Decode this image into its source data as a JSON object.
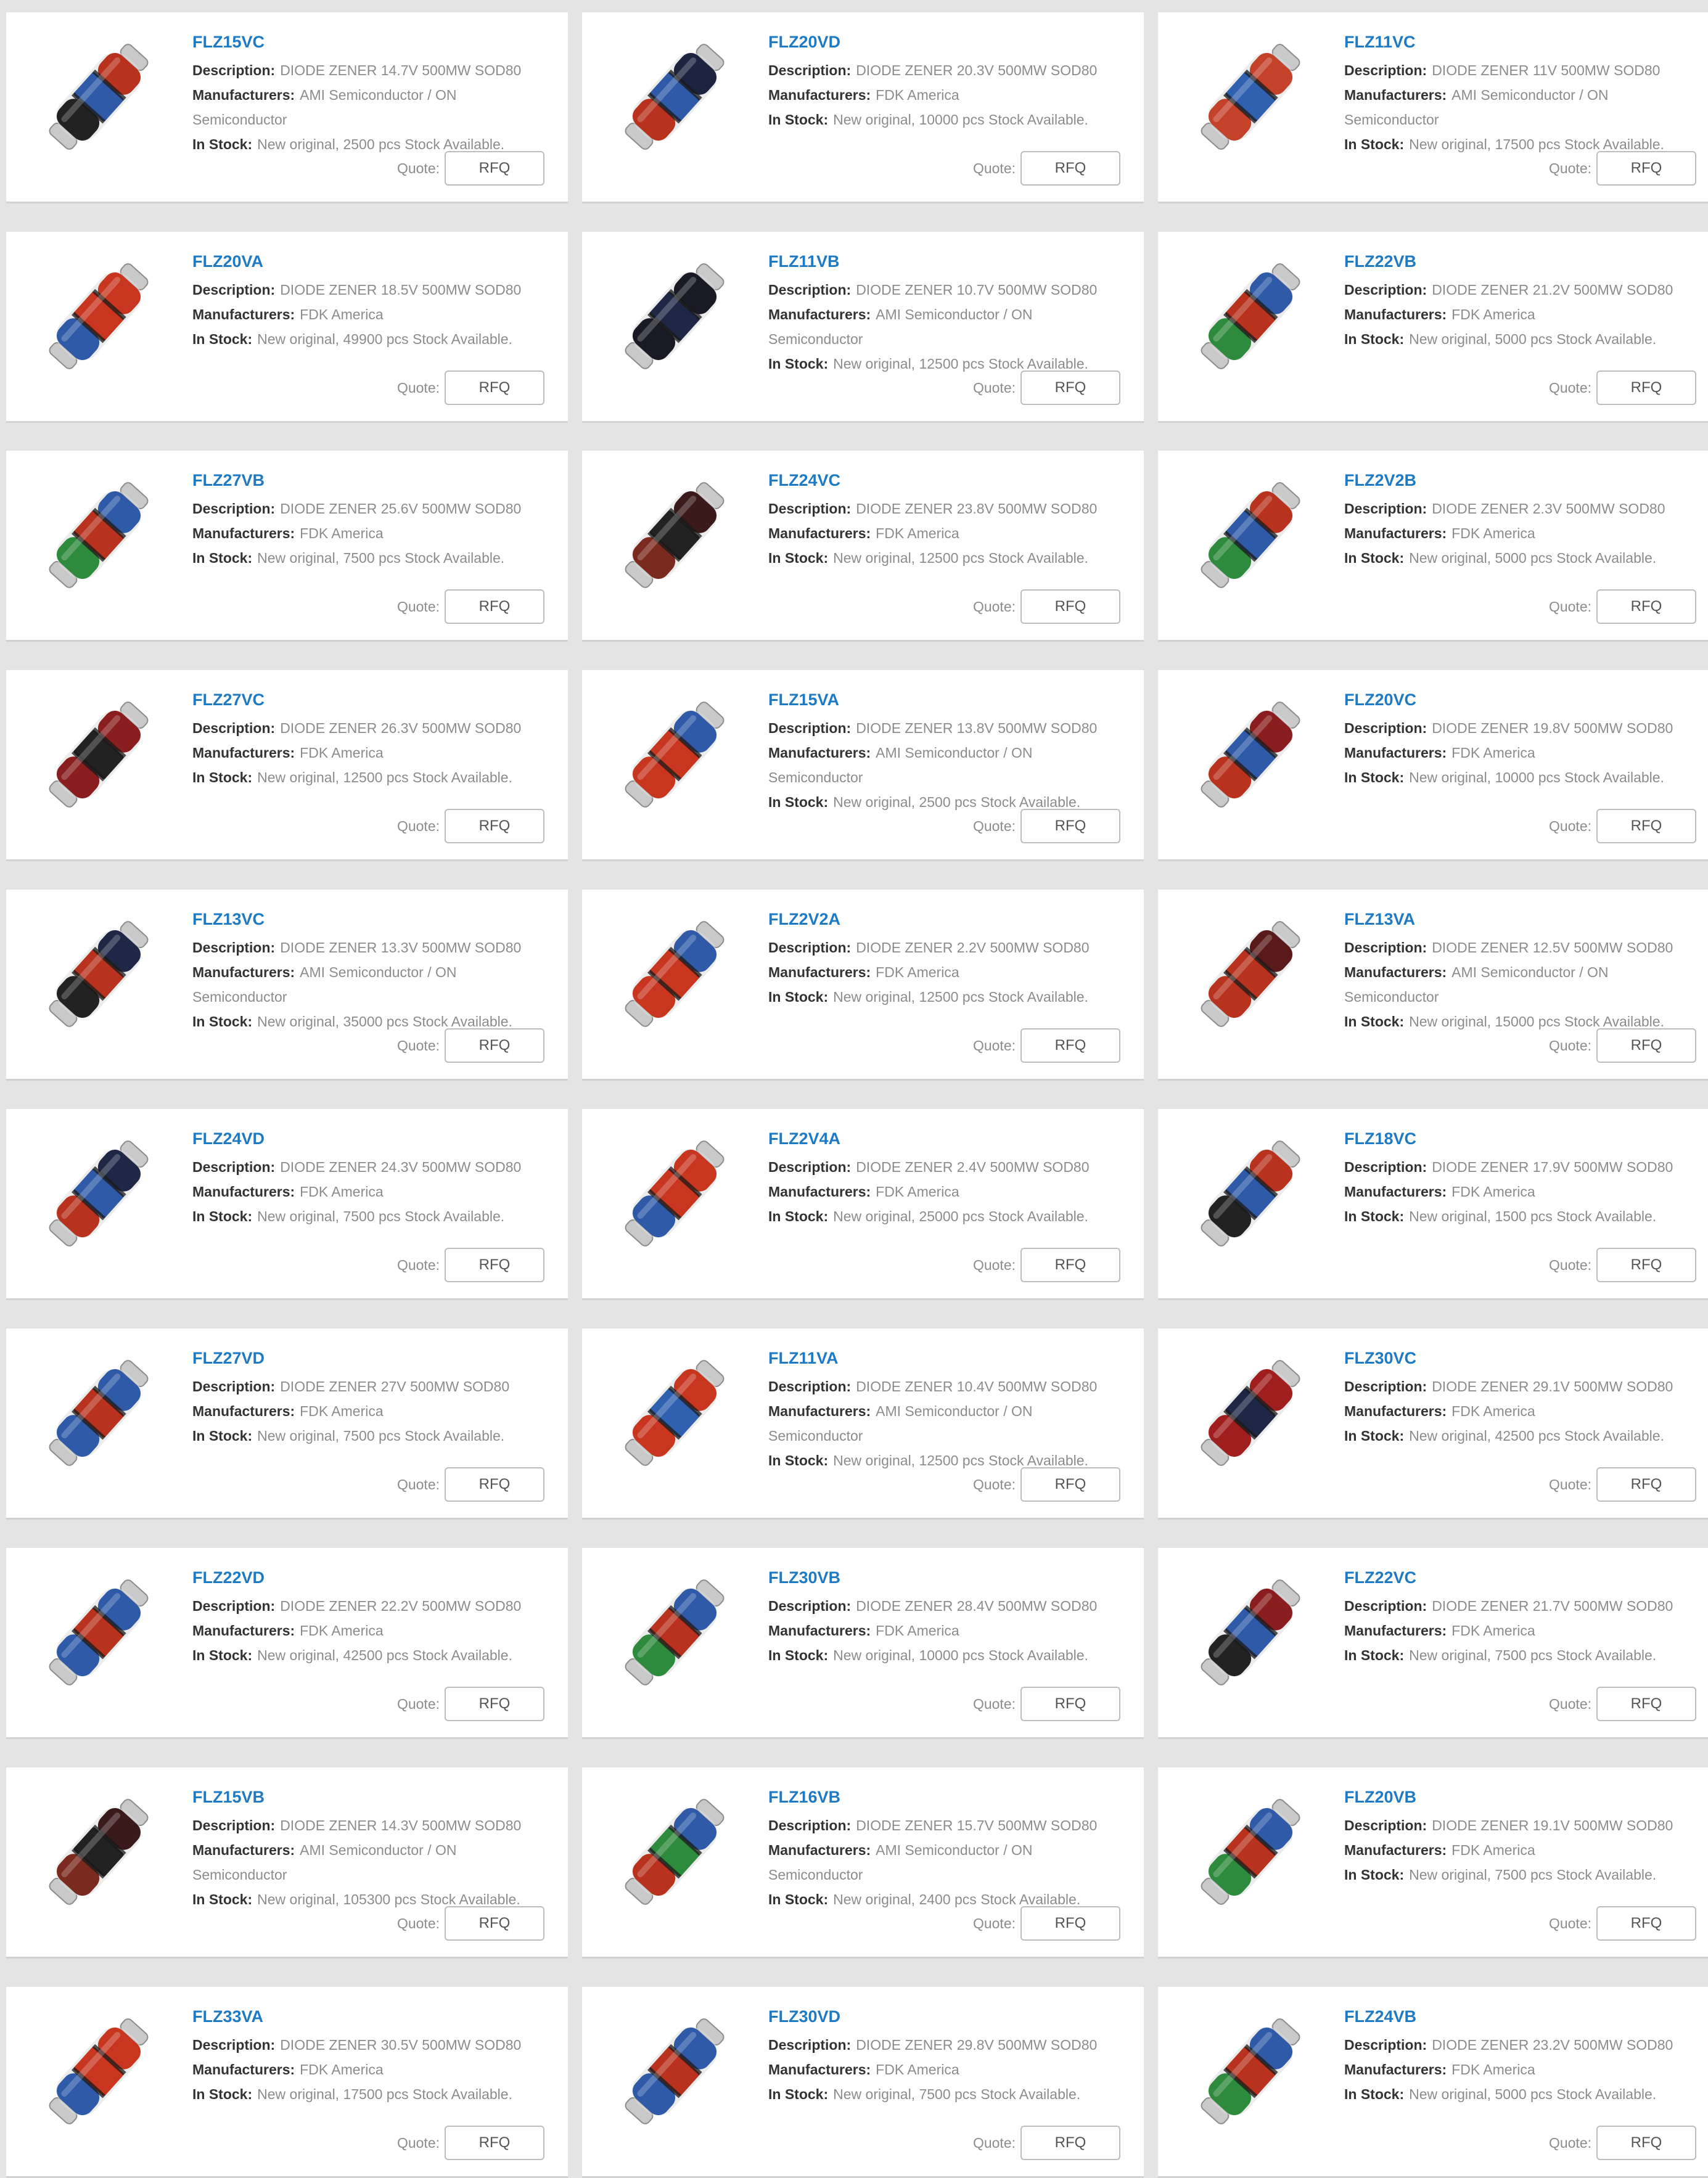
{
  "labels": {
    "description": "Description:",
    "manufacturers": "Manufacturers:",
    "in_stock": "In Stock:",
    "quote": "Quote:",
    "rfq": "RFQ"
  },
  "products": [
    {
      "part": "FLZ15VC",
      "description": "DIODE ZENER 14.7V 500MW SOD80",
      "manufacturer": "AMI Semiconductor / ON Semiconductor",
      "stock": "New original, 2500 pcs Stock Available.",
      "colors": [
        "#b8321e",
        "#2f5aa8",
        "#222222"
      ]
    },
    {
      "part": "FLZ20VD",
      "description": "DIODE ZENER 20.3V 500MW SOD80",
      "manufacturer": "FDK America",
      "stock": "New original, 10000 pcs Stock Available.",
      "colors": [
        "#1d2440",
        "#2f5aa8",
        "#b8321e"
      ]
    },
    {
      "part": "FLZ11VC",
      "description": "DIODE ZENER 11V 500MW SOD80",
      "manufacturer": "AMI Semiconductor / ON Semiconductor",
      "stock": "New original, 17500 pcs Stock Available.",
      "colors": [
        "#c4412a",
        "#3060b0",
        "#c4412a"
      ]
    },
    {
      "part": "FLZ20VA",
      "description": "DIODE ZENER 18.5V 500MW SOD80",
      "manufacturer": "FDK America",
      "stock": "New original, 49900 pcs Stock Available.",
      "colors": [
        "#c8361f",
        "#c8361f",
        "#2f5aa8"
      ]
    },
    {
      "part": "FLZ11VB",
      "description": "DIODE ZENER 10.7V 500MW SOD80",
      "manufacturer": "AMI Semiconductor / ON Semiconductor",
      "stock": "New original, 12500 pcs Stock Available.",
      "colors": [
        "#1a1a26",
        "#1e2846",
        "#1a1a26"
      ]
    },
    {
      "part": "FLZ22VB",
      "description": "DIODE ZENER 21.2V 500MW SOD80",
      "manufacturer": "FDK America",
      "stock": "New original, 5000 pcs Stock Available.",
      "colors": [
        "#2f5aa8",
        "#b8321e",
        "#2e8a3c"
      ]
    },
    {
      "part": "FLZ27VB",
      "description": "DIODE ZENER 25.6V 500MW SOD80",
      "manufacturer": "FDK America",
      "stock": "New original, 7500 pcs Stock Available.",
      "colors": [
        "#2f5aa8",
        "#b8321e",
        "#2e8a3c"
      ]
    },
    {
      "part": "FLZ24VC",
      "description": "DIODE ZENER 23.8V 500MW SOD80",
      "manufacturer": "FDK America",
      "stock": "New original, 12500 pcs Stock Available.",
      "colors": [
        "#3a1a1a",
        "#222222",
        "#7a2a1e"
      ]
    },
    {
      "part": "FLZ2V2B",
      "description": "DIODE ZENER 2.3V 500MW SOD80",
      "manufacturer": "FDK America",
      "stock": "New original, 5000 pcs Stock Available.",
      "colors": [
        "#b8321e",
        "#2f5aa8",
        "#2e8a3c"
      ]
    },
    {
      "part": "FLZ27VC",
      "description": "DIODE ZENER 26.3V 500MW SOD80",
      "manufacturer": "FDK America",
      "stock": "New original, 12500 pcs Stock Available.",
      "colors": [
        "#8a1e1e",
        "#222222",
        "#8a1e1e"
      ]
    },
    {
      "part": "FLZ15VA",
      "description": "DIODE ZENER 13.8V 500MW SOD80",
      "manufacturer": "AMI Semiconductor / ON Semiconductor",
      "stock": "New original, 2500 pcs Stock Available.",
      "colors": [
        "#2f5aa8",
        "#c8361f",
        "#c8361f"
      ]
    },
    {
      "part": "FLZ20VC",
      "description": "DIODE ZENER 19.8V 500MW SOD80",
      "manufacturer": "FDK America",
      "stock": "New original, 10000 pcs Stock Available.",
      "colors": [
        "#8a1e1e",
        "#2f5aa8",
        "#b8321e"
      ]
    },
    {
      "part": "FLZ13VC",
      "description": "DIODE ZENER 13.3V 500MW SOD80",
      "manufacturer": "AMI Semiconductor / ON Semiconductor",
      "stock": "New original, 35000 pcs Stock Available.",
      "colors": [
        "#1e2846",
        "#b8321e",
        "#222222"
      ]
    },
    {
      "part": "FLZ2V2A",
      "description": "DIODE ZENER 2.2V 500MW SOD80",
      "manufacturer": "FDK America",
      "stock": "New original, 12500 pcs Stock Available.",
      "colors": [
        "#2f5aa8",
        "#c8361f",
        "#c8361f"
      ]
    },
    {
      "part": "FLZ13VA",
      "description": "DIODE ZENER 12.5V 500MW SOD80",
      "manufacturer": "AMI Semiconductor / ON Semiconductor",
      "stock": "New original, 15000 pcs Stock Available.",
      "colors": [
        "#5a1a1a",
        "#b8321e",
        "#b8321e"
      ]
    },
    {
      "part": "FLZ24VD",
      "description": "DIODE ZENER 24.3V 500MW SOD80",
      "manufacturer": "FDK America",
      "stock": "New original, 7500 pcs Stock Available.",
      "colors": [
        "#1e2846",
        "#2f5aa8",
        "#b8321e"
      ]
    },
    {
      "part": "FLZ2V4A",
      "description": "DIODE ZENER 2.4V 500MW SOD80",
      "manufacturer": "FDK America",
      "stock": "New original, 25000 pcs Stock Available.",
      "colors": [
        "#c8361f",
        "#c8361f",
        "#2f5aa8"
      ]
    },
    {
      "part": "FLZ18VC",
      "description": "DIODE ZENER 17.9V 500MW SOD80",
      "manufacturer": "FDK America",
      "stock": "New original, 1500 pcs Stock Available.",
      "colors": [
        "#b8321e",
        "#2f5aa8",
        "#222222"
      ]
    },
    {
      "part": "FLZ27VD",
      "description": "DIODE ZENER 27V 500MW SOD80",
      "manufacturer": "FDK America",
      "stock": "New original, 7500 pcs Stock Available.",
      "colors": [
        "#2f5aa8",
        "#b8321e",
        "#2f5aa8"
      ]
    },
    {
      "part": "FLZ11VA",
      "description": "DIODE ZENER 10.4V 500MW SOD80",
      "manufacturer": "AMI Semiconductor / ON Semiconductor",
      "stock": "New original, 12500 pcs Stock Available.",
      "colors": [
        "#c8361f",
        "#3060b0",
        "#c8361f"
      ]
    },
    {
      "part": "FLZ30VC",
      "description": "DIODE ZENER 29.1V 500MW SOD80",
      "manufacturer": "FDK America",
      "stock": "New original, 42500 pcs Stock Available.",
      "colors": [
        "#a01e1e",
        "#1e2846",
        "#a01e1e"
      ]
    },
    {
      "part": "FLZ22VD",
      "description": "DIODE ZENER 22.2V 500MW SOD80",
      "manufacturer": "FDK America",
      "stock": "New original, 42500 pcs Stock Available.",
      "colors": [
        "#2f5aa8",
        "#b8321e",
        "#2f5aa8"
      ]
    },
    {
      "part": "FLZ30VB",
      "description": "DIODE ZENER 28.4V 500MW SOD80",
      "manufacturer": "FDK America",
      "stock": "New original, 10000 pcs Stock Available.",
      "colors": [
        "#2f5aa8",
        "#b8321e",
        "#2e8a3c"
      ]
    },
    {
      "part": "FLZ22VC",
      "description": "DIODE ZENER 21.7V 500MW SOD80",
      "manufacturer": "FDK America",
      "stock": "New original, 7500 pcs Stock Available.",
      "colors": [
        "#8a1e1e",
        "#2f5aa8",
        "#222222"
      ]
    },
    {
      "part": "FLZ15VB",
      "description": "DIODE ZENER 14.3V 500MW SOD80",
      "manufacturer": "AMI Semiconductor / ON Semiconductor",
      "stock": "New original, 105300 pcs Stock Available.",
      "colors": [
        "#3a1a1a",
        "#222222",
        "#7a2a1e"
      ]
    },
    {
      "part": "FLZ16VB",
      "description": "DIODE ZENER 15.7V 500MW SOD80",
      "manufacturer": "AMI Semiconductor / ON Semiconductor",
      "stock": "New original, 2400 pcs Stock Available.",
      "colors": [
        "#2f5aa8",
        "#2e8a3c",
        "#b8321e"
      ]
    },
    {
      "part": "FLZ20VB",
      "description": "DIODE ZENER 19.1V 500MW SOD80",
      "manufacturer": "FDK America",
      "stock": "New original, 7500 pcs Stock Available.",
      "colors": [
        "#2f5aa8",
        "#b8321e",
        "#2e8a3c"
      ]
    },
    {
      "part": "FLZ33VA",
      "description": "DIODE ZENER 30.5V 500MW SOD80",
      "manufacturer": "FDK America",
      "stock": "New original, 17500 pcs Stock Available.",
      "colors": [
        "#c8361f",
        "#c8361f",
        "#2f5aa8"
      ]
    },
    {
      "part": "FLZ30VD",
      "description": "DIODE ZENER 29.8V 500MW SOD80",
      "manufacturer": "FDK America",
      "stock": "New original, 7500 pcs Stock Available.",
      "colors": [
        "#2f5aa8",
        "#b8321e",
        "#2f5aa8"
      ]
    },
    {
      "part": "FLZ24VB",
      "description": "DIODE ZENER 23.2V 500MW SOD80",
      "manufacturer": "FDK America",
      "stock": "New original, 5000 pcs Stock Available.",
      "colors": [
        "#2f5aa8",
        "#b8321e",
        "#2e8a3c"
      ]
    }
  ]
}
